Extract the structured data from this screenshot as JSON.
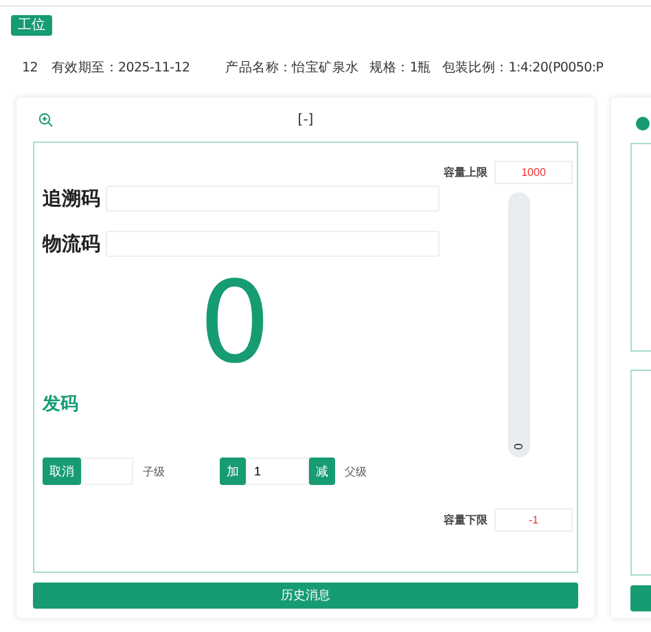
{
  "station_tag": "工位",
  "info": [
    "12",
    "有效期至：2025-11-12",
    "产品名称：怡宝矿泉水",
    "规格：1瓶",
    "包装比例：1:4:20(P0050:P"
  ],
  "panel": {
    "header": "[-]",
    "fields": [
      {
        "label": "追溯码"
      },
      {
        "label": "物流码"
      }
    ],
    "count": "0",
    "send_label": "发码",
    "child": {
      "button": "取消",
      "label": "子级"
    },
    "parent": {
      "add": "加",
      "value": "1",
      "subtract": "减",
      "label": "父级"
    },
    "capacity_max": {
      "label": "容量上限",
      "value": "1000"
    },
    "capacity_meter": {
      "level": 0,
      "reading": "0"
    },
    "capacity_min": {
      "label": "容量下限",
      "value": "-1"
    },
    "history_button": "历史消息"
  },
  "second_panel": {
    "active": true
  }
}
